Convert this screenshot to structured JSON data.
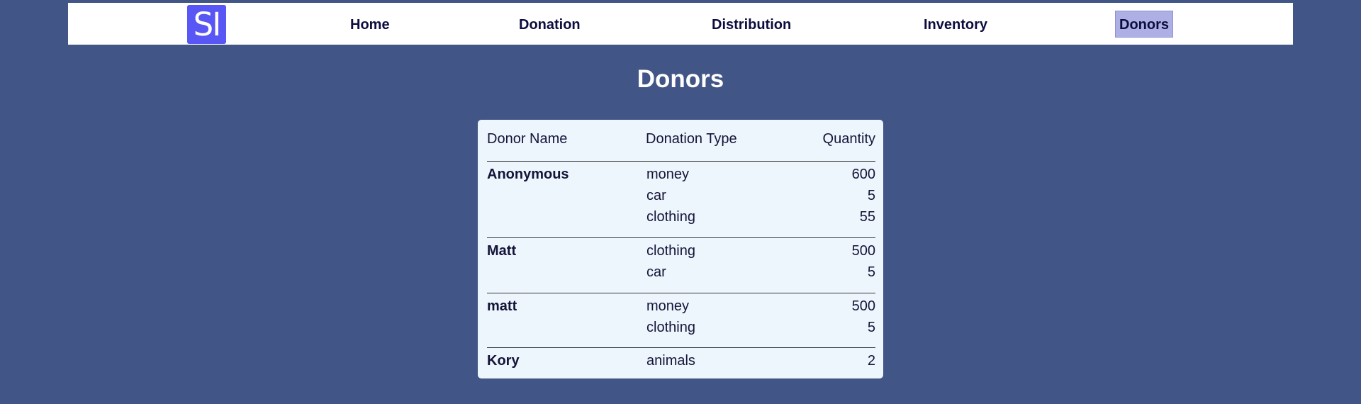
{
  "nav": {
    "logo_text": "SI",
    "links": [
      {
        "label": "Home"
      },
      {
        "label": "Donation"
      },
      {
        "label": "Distribution"
      },
      {
        "label": "Inventory"
      },
      {
        "label": "Donors"
      }
    ],
    "active": "Donors"
  },
  "page": {
    "title": "Donors"
  },
  "table": {
    "headers": {
      "name": "Donor Name",
      "type": "Donation Type",
      "quantity": "Quantity"
    },
    "rows": [
      {
        "name": "Anonymous",
        "donations": [
          {
            "type": "money",
            "quantity": "600"
          },
          {
            "type": "car",
            "quantity": "5"
          },
          {
            "type": "clothing",
            "quantity": "55"
          }
        ]
      },
      {
        "name": "Matt",
        "donations": [
          {
            "type": "clothing",
            "quantity": "500"
          },
          {
            "type": "car",
            "quantity": "5"
          }
        ]
      },
      {
        "name": "matt",
        "donations": [
          {
            "type": "money",
            "quantity": "500"
          },
          {
            "type": "clothing",
            "quantity": "5"
          }
        ]
      },
      {
        "name": "Kory",
        "donations": [
          {
            "type": "animals",
            "quantity": "2"
          }
        ]
      }
    ]
  },
  "colors": {
    "page_background": "#415587",
    "navbar_background": "#ffffff",
    "logo_background": "#5856f4",
    "active_link_background": "#aeb0e5",
    "card_background": "#eef6fd",
    "text_dark": "#0c0c3e"
  }
}
